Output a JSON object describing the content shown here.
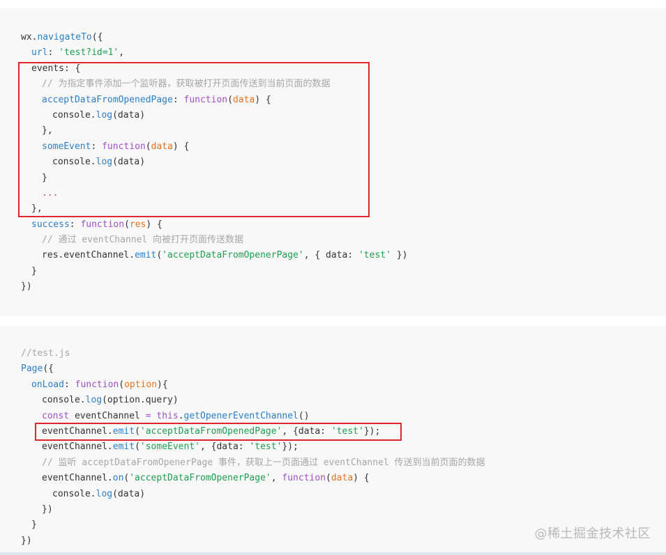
{
  "watermark": "@稀土掘金技术社区",
  "block1": {
    "l1_obj": "wx.",
    "l1_fn": "navigateTo",
    "l1_rest": "({",
    "l2_key": "url",
    "l2_colon": ": ",
    "l2_str": "'test?id=1'",
    "l2_end": ",",
    "l3": "events: {",
    "l4_comment": "// 为指定事件添加一个监听器，获取被打开页面传送到当前页面的数据",
    "l5_key": "acceptDataFromOpenedPage",
    "l5_colon": ": ",
    "l5_kw": "function",
    "l5_open": "(",
    "l5_param": "data",
    "l5_close": ") {",
    "l6_obj": "console.",
    "l6_fn": "log",
    "l6_rest": "(data)",
    "l7": "},",
    "l8_key": "someEvent",
    "l8_colon": ": ",
    "l8_kw": "function",
    "l8_open": "(",
    "l8_param": "data",
    "l8_close": ") {",
    "l9_obj": "console.",
    "l9_fn": "log",
    "l9_rest": "(data)",
    "l10": "}",
    "l11": "...",
    "l12": "},",
    "l13_key": "success",
    "l13_colon": ": ",
    "l13_kw": "function",
    "l13_open": "(",
    "l13_param": "res",
    "l13_close": ") {",
    "l14_comment": "// 通过 eventChannel 向被打开页面传送数据",
    "l15_obj": "res.eventChannel.",
    "l15_fn": "emit",
    "l15_open": "(",
    "l15_str": "'acceptDataFromOpenerPage'",
    "l15_mid": ", { data: ",
    "l15_str2": "'test'",
    "l15_close": " })",
    "l16": "}",
    "l17": "})"
  },
  "block2": {
    "l1_comment": "//test.js",
    "l2_fn": "Page",
    "l2_rest": "({",
    "l3_key": "onLoad",
    "l3_colon": ": ",
    "l3_kw": "function",
    "l3_open": "(",
    "l3_param": "option",
    "l3_close": "){",
    "l4_obj": "console.",
    "l4_fn": "log",
    "l4_rest": "(option.query)",
    "l5_kw": "const",
    "l5_mid": " eventChannel ",
    "l5_eq": "=",
    "l5_sp": " ",
    "l5_this": "this",
    "l5_dot": ".",
    "l5_fn": "getOpenerEventChannel",
    "l5_rest": "()",
    "l6_obj": "eventChannel.",
    "l6_fn": "emit",
    "l6_open": "(",
    "l6_str": "'acceptDataFromOpenedPage'",
    "l6_mid": ", {data: ",
    "l6_str2": "'test'",
    "l6_close": "});",
    "l7_obj": "eventChannel.",
    "l7_fn": "emit",
    "l7_open": "(",
    "l7_str": "'someEvent'",
    "l7_mid": ", {data: ",
    "l7_str2": "'test'",
    "l7_close": "});",
    "l8_comment": "// 监听 acceptDataFromOpenerPage 事件，获取上一页面通过 eventChannel 传送到当前页面的数据",
    "l9_obj": "eventChannel.",
    "l9_fn": "on",
    "l9_open": "(",
    "l9_str": "'acceptDataFromOpenerPage'",
    "l9_mid": ", ",
    "l9_kw": "function",
    "l9_popen": "(",
    "l9_param": "data",
    "l9_close": ") {",
    "l10_obj": "console.",
    "l10_fn": "log",
    "l10_rest": "(data)",
    "l11": "})",
    "l12": "}",
    "l13": "})"
  }
}
